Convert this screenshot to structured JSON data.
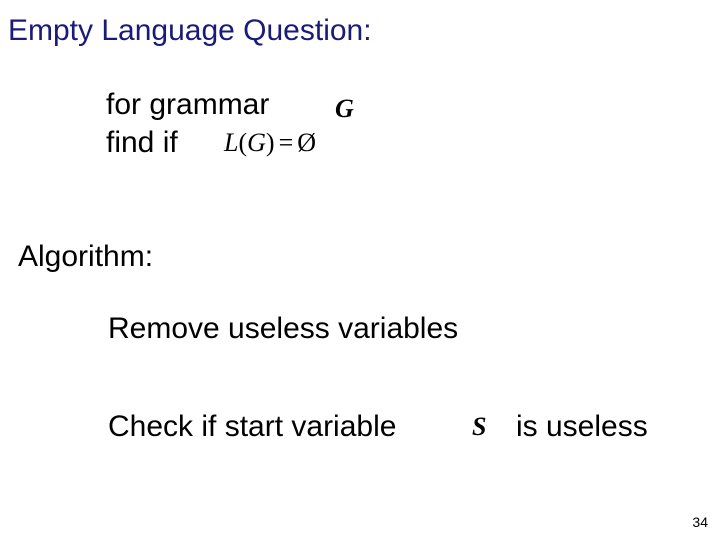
{
  "title": "Empty Language Question:",
  "line1": "for grammar",
  "line2": "find if",
  "symbol_G": "G",
  "formula": {
    "L": "L",
    "paren_open": "(",
    "G": "G",
    "paren_close": ")",
    "eq": "=",
    "empty": "Ø"
  },
  "algorithm_label": "Algorithm:",
  "step1": "Remove useless variables",
  "step2_a": "Check if start variable",
  "symbol_S": "S",
  "step2_b": "is useless",
  "page_number": "34"
}
